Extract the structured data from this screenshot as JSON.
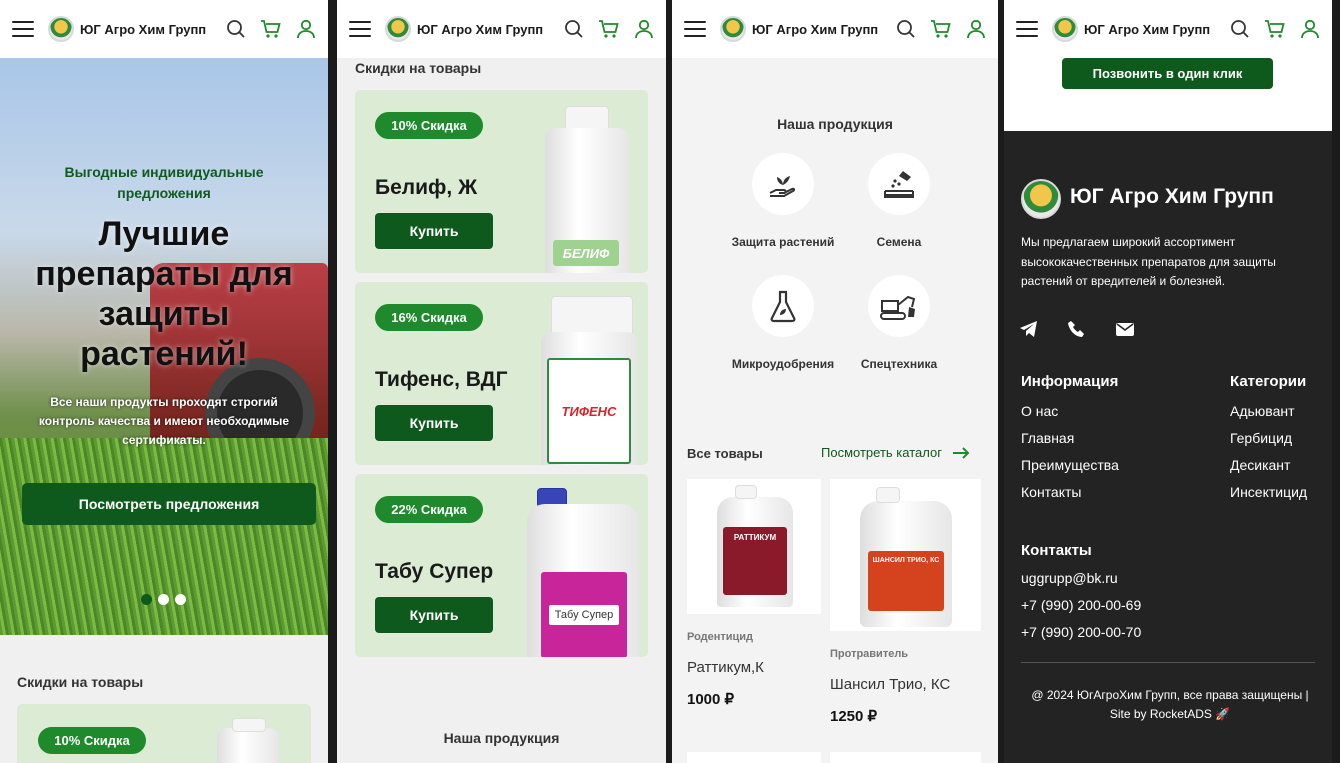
{
  "brand": "ЮГ Агро Хим Групп",
  "colors": {
    "accent": "#0d5a1c",
    "badge": "#1f8a2c",
    "card_bg": "#dcebd3",
    "footer_bg": "#232323"
  },
  "panel1": {
    "hero": {
      "subtitle": "Выгодные индивидуальные предложения",
      "title": "Лучшие препараты для защиты растений!",
      "description": "Все наши продукты проходят строгий контроль качества и имеют необходимые сертификаты.",
      "button": "Посмотреть предложения"
    },
    "section_title": "Скидки на товары",
    "first_badge": "10% Скидка"
  },
  "panel2": {
    "section_title": "Скидки на товары",
    "discounts": [
      {
        "badge": "10% Скидка",
        "name": "Белиф, Ж",
        "button": "Купить",
        "label": "БЕЛИФ"
      },
      {
        "badge": "16% Скидка",
        "name": "Тифенс, ВДГ",
        "button": "Купить",
        "label": "ТИФЕНС"
      },
      {
        "badge": "22% Скидка",
        "name": "Табу Супер",
        "button": "Купить",
        "label": "Табу Супер"
      }
    ],
    "bottom_title": "Наша продукция"
  },
  "panel3": {
    "section_title": "Наша продукция",
    "categories": [
      {
        "label": "Защита растений",
        "icon": "hand-plant-icon"
      },
      {
        "label": "Семена",
        "icon": "seeds-icon"
      },
      {
        "label": "Микроудобрения",
        "icon": "flask-icon"
      },
      {
        "label": "Спецтехника",
        "icon": "excavator-icon"
      }
    ],
    "all_products": "Все товары",
    "catalog_link": "Посмотреть каталог",
    "products": [
      {
        "type": "Родентицид",
        "name": "Раттикум,К",
        "price": "1000 ₽",
        "label": "РАТТИКУМ"
      },
      {
        "type": "Протравитель",
        "name": "Шансил Трио, КС",
        "price": "1250 ₽",
        "label": "ШАНСИЛ ТРИО, КС"
      }
    ]
  },
  "panel4": {
    "call_button": "Позвонить в один клик",
    "footer": {
      "brand": "ЮГ Агро Хим Групп",
      "description": "Мы предлагаем широкий ассортимент высококачественных препаратов для защиты растений от вредителей и болезней.",
      "info_title": "Информация",
      "info_links": [
        "О нас",
        "Главная",
        "Преимущества",
        "Контакты"
      ],
      "cat_title": "Категории",
      "cat_links": [
        "Адьювант",
        "Гербицид",
        "Десикант",
        "Инсектицид"
      ],
      "contacts_title": "Контакты",
      "email": "uggrupp@bk.ru",
      "phones": [
        "+7 (990) 200-00-69",
        "+7 (990) 200-00-70"
      ],
      "copyright": "@ 2024 ЮгАгроХим Групп, все права защищены |",
      "site_by": "Site by RocketADS"
    }
  }
}
